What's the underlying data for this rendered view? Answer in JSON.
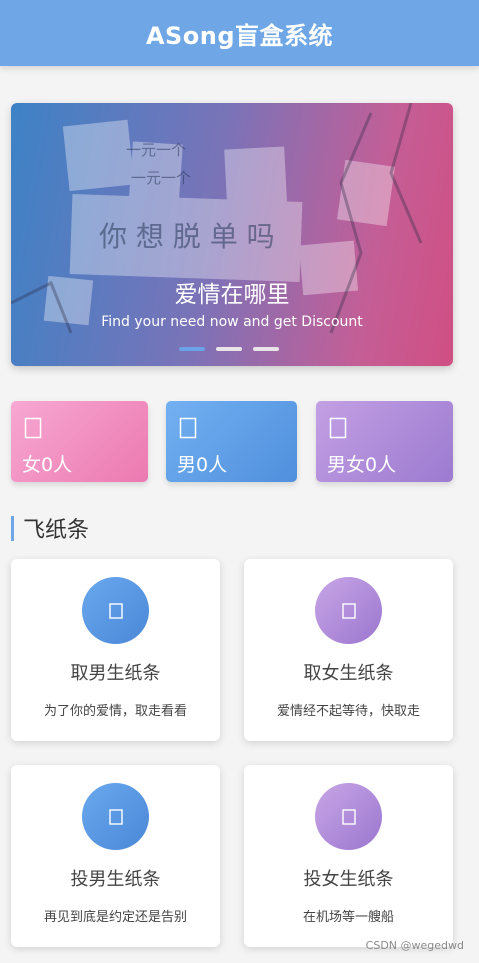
{
  "header": {
    "title": "ASong盲盒系统"
  },
  "banner": {
    "title": "爱情在哪里",
    "subtitle": "Find your need now and get Discount",
    "dots": 3,
    "active_dot": 0,
    "photo_text": [
      "一元一个",
      "一元一个",
      "你 想 脱 单 吗"
    ]
  },
  "stats": [
    {
      "icon": "female-icon",
      "label": "女0人",
      "color": "#ec79b1"
    },
    {
      "icon": "male-icon",
      "label": "男0人",
      "color": "#4f8fdc"
    },
    {
      "icon": "couple-icon",
      "label": "男女0人",
      "color": "#9c7ad0"
    }
  ],
  "section": {
    "title": "飞纸条"
  },
  "cards": [
    {
      "title": "取男生纸条",
      "desc": "为了你的爱情，取走看看",
      "icon": "take-note-icon",
      "color": "#4a88d8"
    },
    {
      "title": "取女生纸条",
      "desc": "爱情经不起等待，快取走",
      "icon": "take-note-icon",
      "color": "#9b76cf"
    },
    {
      "title": "投男生纸条",
      "desc": "再见到底是约定还是告别",
      "icon": "drop-note-icon",
      "color": "#4a88d8"
    },
    {
      "title": "投女生纸条",
      "desc": "在机场等一艘船",
      "icon": "drop-note-icon",
      "color": "#9b76cf"
    }
  ],
  "watermark": "CSDN @wegedwd"
}
